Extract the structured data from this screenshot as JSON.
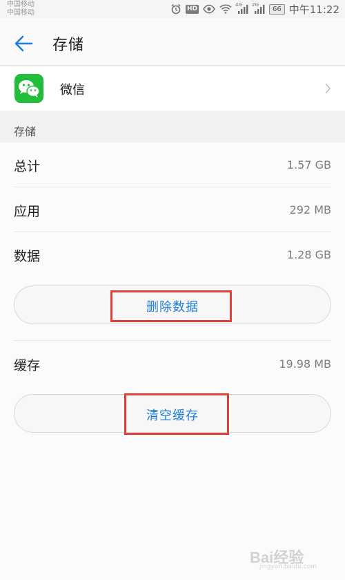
{
  "status_bar": {
    "carrier_1": "中国移动",
    "carrier_2": "中国移动",
    "hd": "HD",
    "net_1": "4G",
    "net_2": "2G",
    "battery": "66",
    "time": "中午11:22"
  },
  "header": {
    "title": "存储",
    "back_icon": "arrow-left-icon"
  },
  "app": {
    "name": "微信",
    "icon": "wechat-icon"
  },
  "section": {
    "label": "存储"
  },
  "storage": {
    "rows": [
      {
        "label": "总计",
        "value": "1.57 GB"
      },
      {
        "label": "应用",
        "value": "292 MB"
      },
      {
        "label": "数据",
        "value": "1.28 GB"
      }
    ],
    "clear_data_label": "删除数据",
    "cache": {
      "label": "缓存",
      "value": "19.98 MB"
    },
    "clear_cache_label": "清空缓存"
  },
  "colors": {
    "accent": "#1d7fd9",
    "wechat_green": "#22bd3a",
    "highlight_red": "#e0403b"
  },
  "watermark": {
    "logo": "Bai经验",
    "url": "jingyan.baidu.com"
  }
}
